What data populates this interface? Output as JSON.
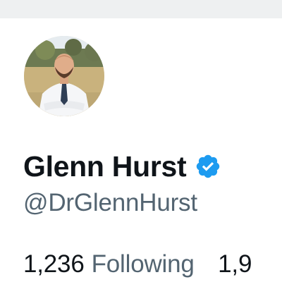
{
  "profile": {
    "avatar_icon": "profile-photo",
    "display_name": "Glenn Hurst",
    "verified_icon": "verified-badge-icon",
    "handle": "@DrGlennHurst"
  },
  "stats": {
    "following_count": "1,236",
    "following_label": "Following",
    "followers_count_partial": "1,9"
  },
  "colors": {
    "text_primary": "#0f1419",
    "text_secondary": "#536471",
    "verified_blue": "#1d9bf0",
    "background": "#ffffff"
  }
}
